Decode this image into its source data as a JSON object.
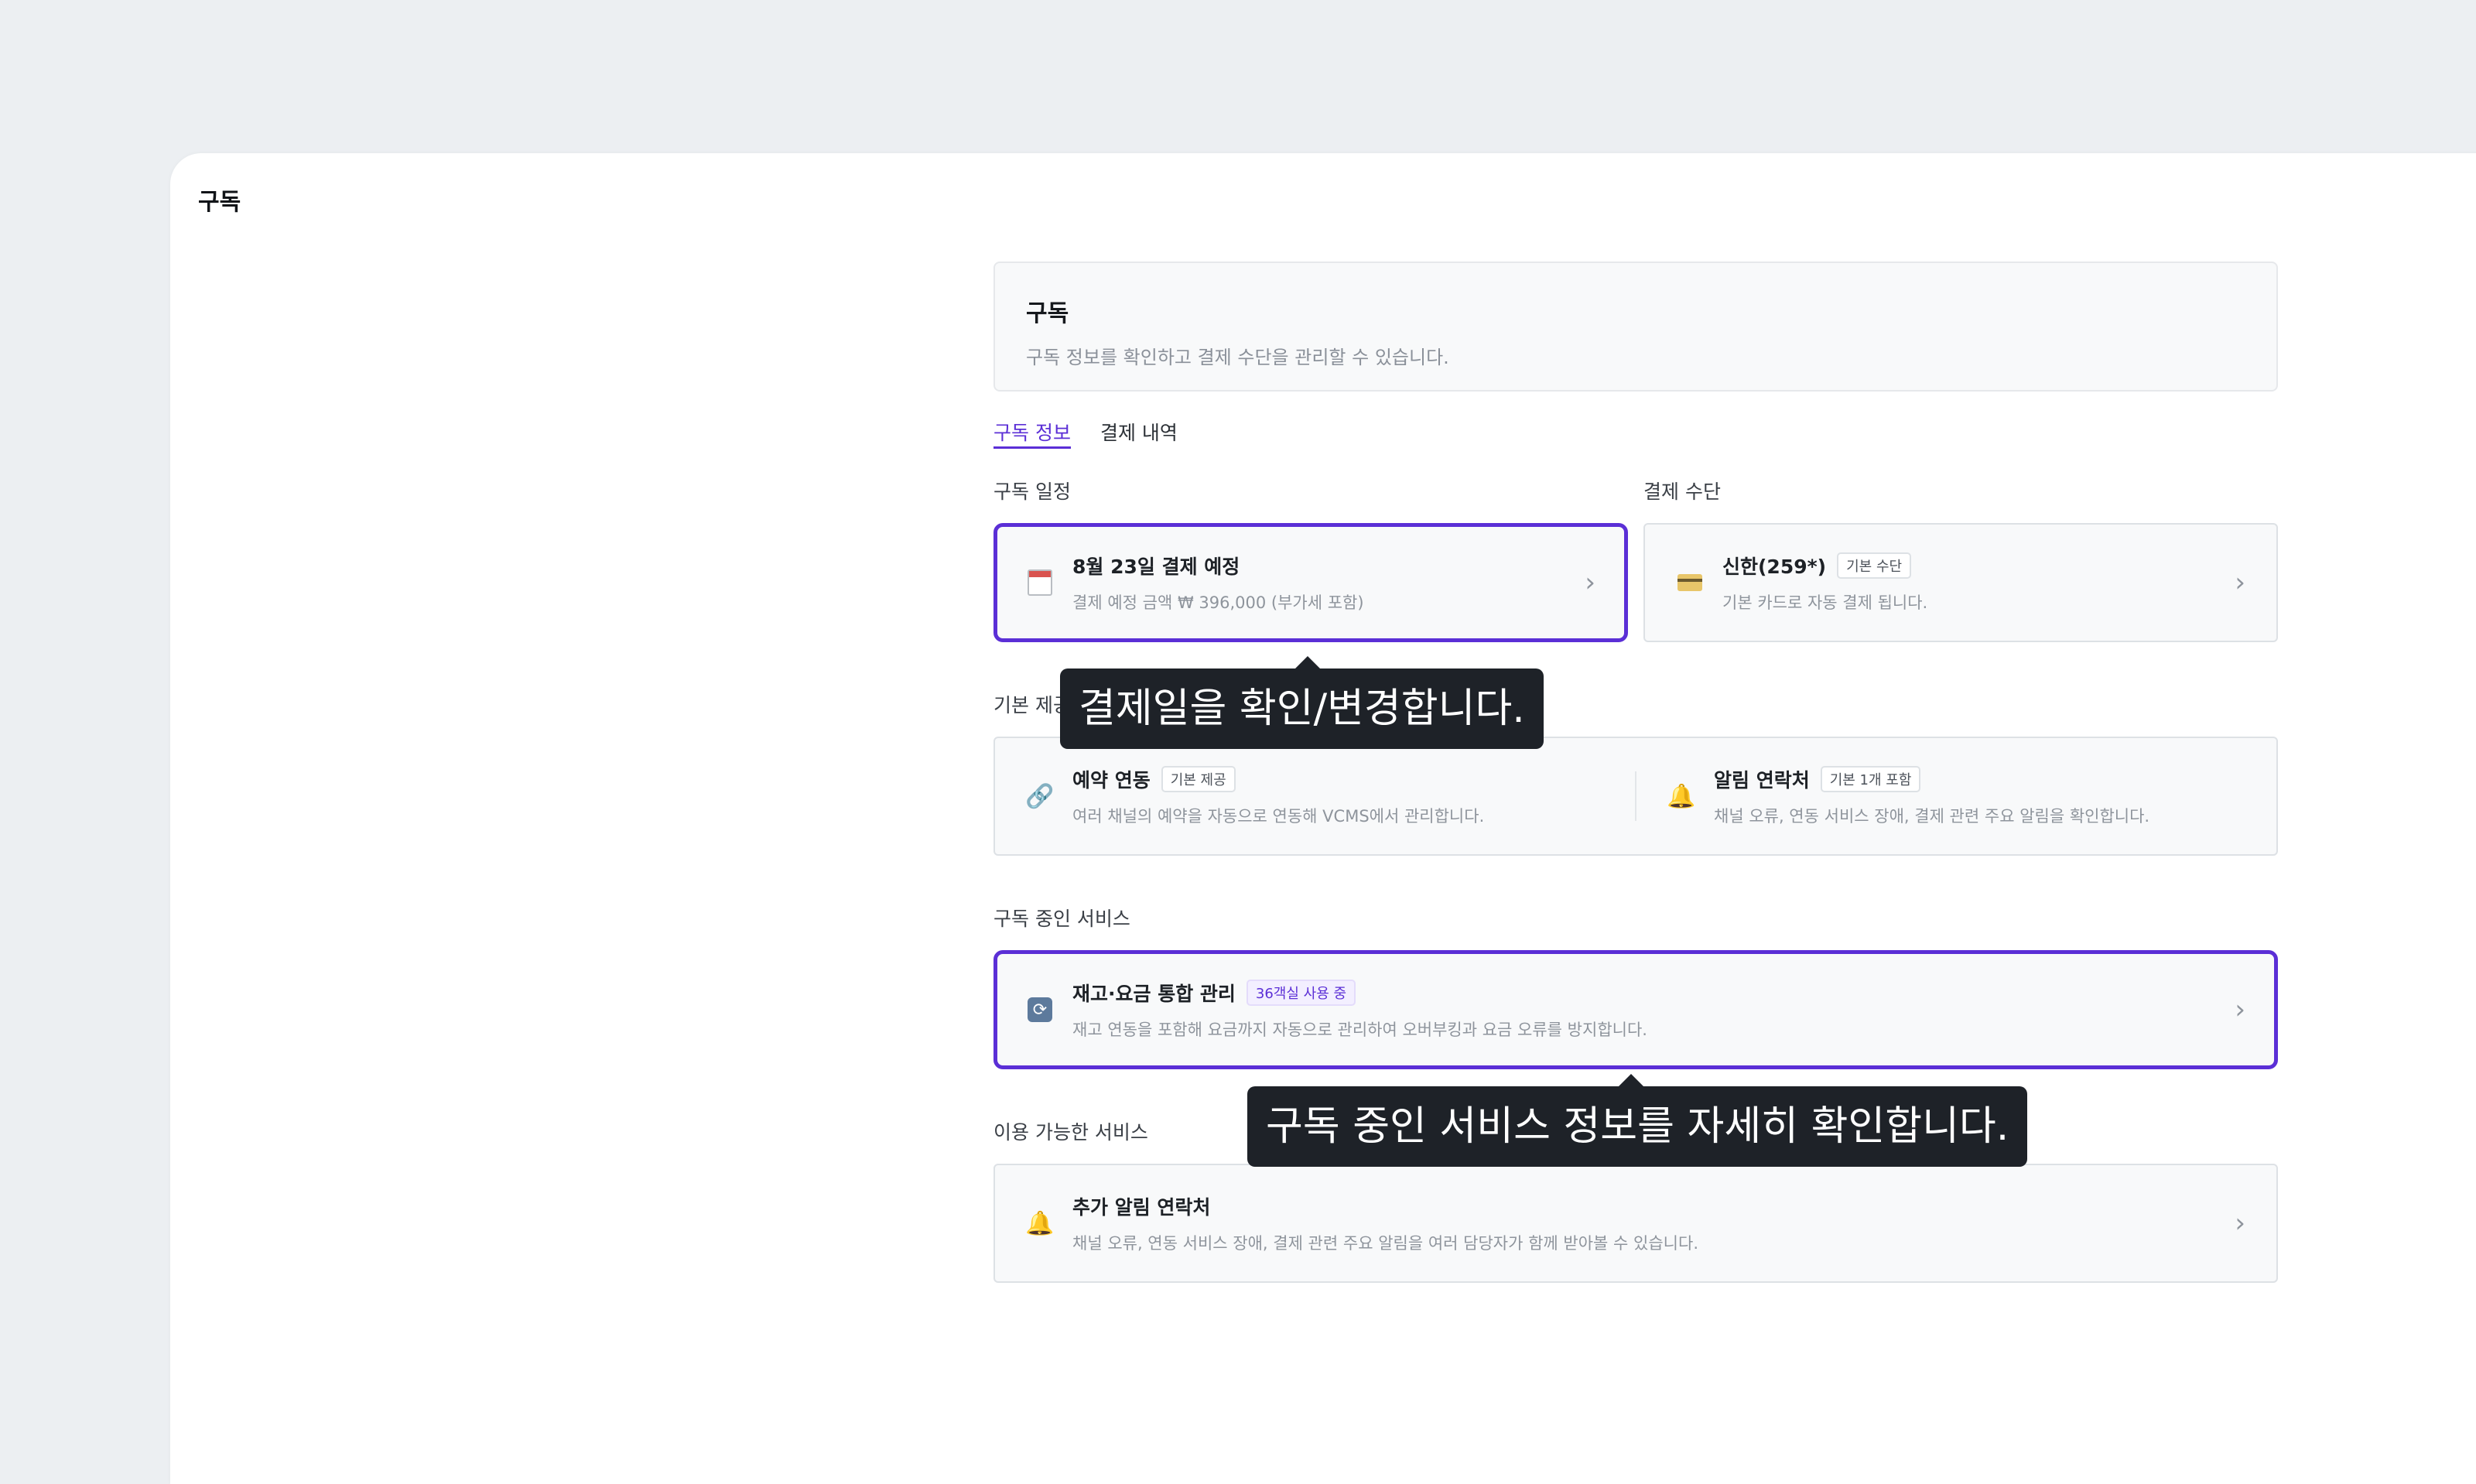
{
  "window": {
    "title": "구독"
  },
  "header": {
    "title": "구독",
    "subtitle": "구독 정보를 확인하고 결제 수단을 관리할 수 있습니다."
  },
  "tabs": [
    {
      "label": "구독 정보",
      "active": true
    },
    {
      "label": "결제 내역",
      "active": false
    }
  ],
  "schedule": {
    "label": "구독 일정",
    "icon": "calendar-icon",
    "title": "8월 23일 결제 예정",
    "desc": "결제 예정 금액 ₩ 396,000 (부가세 포함)"
  },
  "payment": {
    "label": "결제 수단",
    "icon": "credit-card-icon",
    "title": "신한(259*)",
    "badge": "기본 수단",
    "desc": "기본 카드로 자동 결제 됩니다."
  },
  "basic": {
    "label": "기본 제공",
    "items": [
      {
        "icon": "link-icon",
        "title": "예약 연동",
        "badge": "기본 제공",
        "desc": "여러 채널의 예약을 자동으로 연동해 VCMS에서 관리합니다."
      },
      {
        "icon": "bell-icon",
        "title": "알림 연락처",
        "badge": "기본 1개 포함",
        "desc": "채널 오류, 연동 서비스 장애, 결제 관련 주요 알림을 확인합니다."
      }
    ]
  },
  "subscribed": {
    "label": "구독 중인 서비스",
    "icon": "sync-icon",
    "title": "재고·요금 통합 관리",
    "badge": "36객실 사용 중",
    "desc": "재고 연동을 포함해 요금까지 자동으로 관리하여 오버부킹과 요금 오류를 방지합니다."
  },
  "available": {
    "label": "이용 가능한 서비스",
    "icon": "bell-icon",
    "title": "추가 알림 연락처",
    "desc": "채널 오류, 연동 서비스 장애, 결제 관련 주요 알림을 여러 담당자가 함께 받아볼 수 있습니다."
  },
  "tooltips": {
    "schedule": "결제일을 확인/변경합니다.",
    "subscribed": "구독 중인 서비스 정보를 자세히 확인합니다."
  },
  "colors": {
    "accent": "#5b2fd6",
    "tooltip_bg": "#1e2228",
    "background": "#eceff2"
  }
}
